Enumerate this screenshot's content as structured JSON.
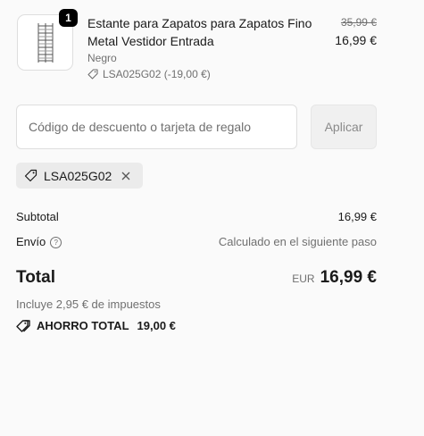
{
  "product": {
    "quantity": "1",
    "title": "Estante para Zapatos para Zapatos Fino Metal Vestidor Entrada",
    "variant": "Negro",
    "discount_applied": "LSA025G02 (-19,00 €)",
    "price_original": "35,99 €",
    "price_current": "16,99 €",
    "image_icon": "shoe-rack-image"
  },
  "discount": {
    "placeholder": "Código de descuento o tarjeta de regalo",
    "value": "",
    "apply_label": "Aplicar",
    "code_chip": "LSA025G02",
    "remove_icon": "close-icon"
  },
  "summary": {
    "subtotal_label": "Subtotal",
    "subtotal_value": "16,99 €",
    "shipping_label": "Envío",
    "shipping_value": "Calculado en el siguiente paso",
    "total_label": "Total",
    "currency": "EUR",
    "total_value": "16,99 €",
    "taxes_text": "Incluye 2,95 € de impuestos",
    "savings_label": "AHORRO TOTAL",
    "savings_value": "19,00 €"
  }
}
